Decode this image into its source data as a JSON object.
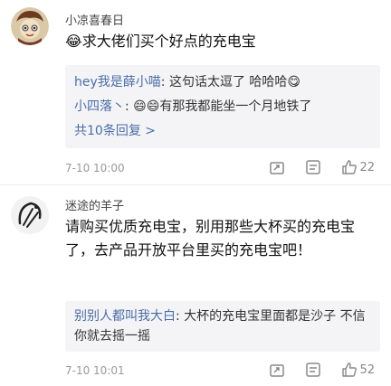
{
  "comments": [
    {
      "username": "小凉喜春日",
      "text": "😂求大佬们买个好点的充电宝",
      "replies": [
        {
          "name": "hey我是薛小喵",
          "text": ": 这句话太逗了 哈哈哈😋"
        },
        {
          "name": "小四落丶",
          "text": ": 😄😄有那我都能坐一个月地铁了"
        }
      ],
      "reply_more": "共10条回复 >",
      "time": "7-10 10:00",
      "likes": "22"
    },
    {
      "username": "迷途的羊子",
      "text": "请购买优质充电宝，别用那些大杯买的充电宝了，去产品开放平台里买的充电宝吧！",
      "replies": [
        {
          "name": "别别人都叫我大白",
          "text": ": 大杯的充电宝里面都是沙子 不信你就去摇一摇"
        }
      ],
      "time": "7-10 10:01",
      "likes": "52"
    }
  ],
  "icons": {
    "share": "share-icon",
    "comment": "comment-icon",
    "like": "thumbs-up-icon"
  }
}
